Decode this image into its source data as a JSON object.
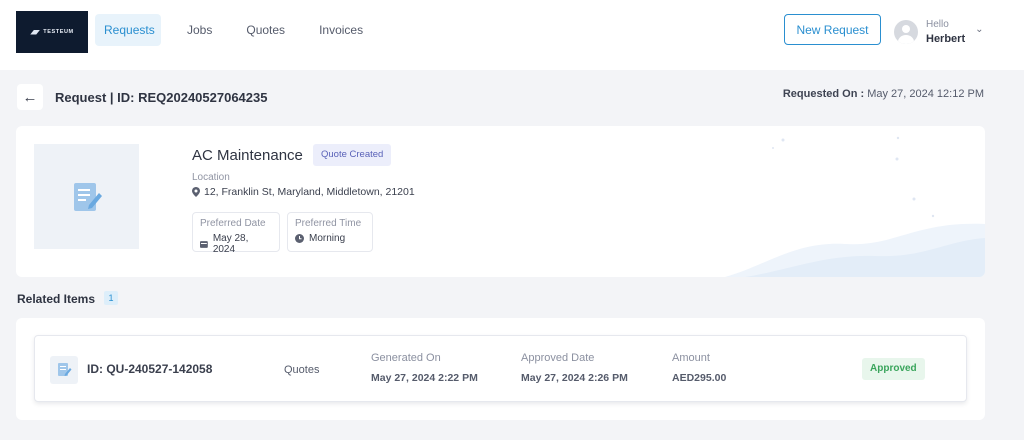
{
  "brand": {
    "logo_text": "TESTEUM"
  },
  "nav": {
    "items": [
      {
        "label": "Requests"
      },
      {
        "label": "Jobs"
      },
      {
        "label": "Quotes"
      },
      {
        "label": "Invoices"
      }
    ]
  },
  "header": {
    "new_request_label": "New Request",
    "user_greeting": "Hello",
    "user_name": "Herbert"
  },
  "page": {
    "title": "Request | ID: REQ20240527064235",
    "requested_on_label": "Requested On :",
    "requested_on_value": "May 27, 2024 12:12 PM"
  },
  "request": {
    "title": "AC Maintenance",
    "status": "Quote Created",
    "location_label": "Location",
    "location_value": "12, Franklin St, Maryland, Middletown, 21201",
    "preferred_date_label": "Preferred Date",
    "preferred_date_value": "May 28, 2024",
    "preferred_time_label": "Preferred Time",
    "preferred_time_value": "Morning"
  },
  "related": {
    "title": "Related Items",
    "count": "1",
    "items": [
      {
        "id": "ID: QU-240527-142058",
        "type": "Quotes",
        "generated_label": "Generated On",
        "generated_value": "May 27, 2024 2:22 PM",
        "approved_label": "Approved Date",
        "approved_value": "May 27, 2024 2:26 PM",
        "amount_label": "Amount",
        "amount_value": "AED295.00",
        "status": "Approved"
      }
    ]
  },
  "colors": {
    "accent": "#2a8fd0",
    "logo_bg": "#0e1b2f",
    "approved": "#3aa55c",
    "quote_badge": "#5a62b8"
  }
}
